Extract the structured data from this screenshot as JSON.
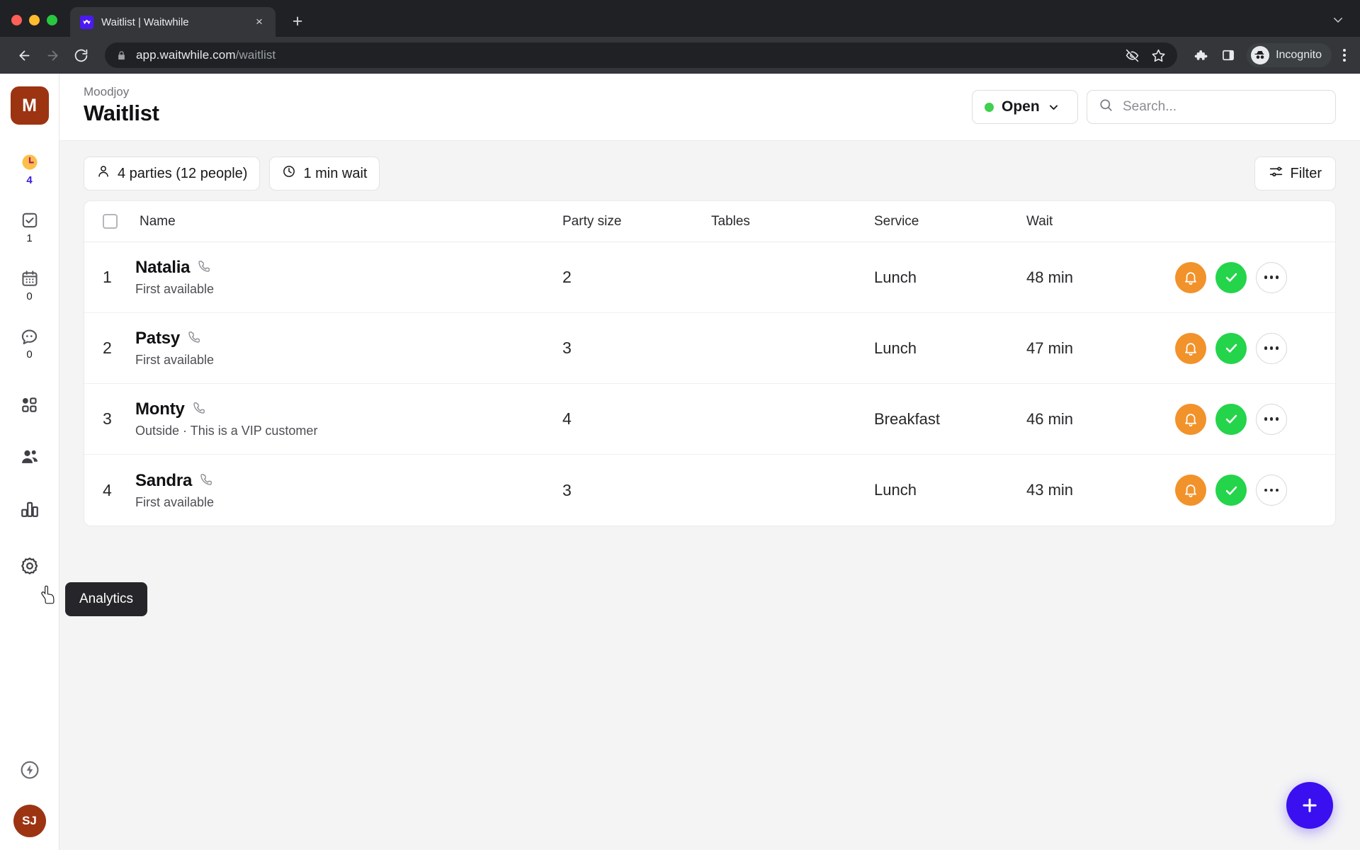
{
  "browser": {
    "tab": {
      "title": "Waitlist | Waitwhile",
      "favicon_name": "waitwhile-logo-icon",
      "close_label": "×"
    },
    "newtab_label": "+",
    "tabstrip_overflow_label": "⌄",
    "url": {
      "domain": "app.waitwhile.com",
      "path": "/waitlist"
    },
    "profile": {
      "label": "Incognito"
    },
    "icons": {
      "back": "back-arrow-icon",
      "forward": "forward-arrow-icon",
      "reload": "reload-icon",
      "lock": "lock-icon",
      "tracking_blocked": "eye-off-icon",
      "bookmark": "star-icon",
      "extensions": "puzzle-piece-icon",
      "side_panel": "side-panel-icon",
      "menu": "three-dot-menu-icon"
    }
  },
  "sidebar": {
    "brand_initial": "M",
    "items": [
      {
        "name": "waitlist",
        "icon": "clock-icon",
        "count": "4",
        "active": true
      },
      {
        "name": "served",
        "icon": "checkbox-check-icon",
        "count": "1",
        "active": false
      },
      {
        "name": "bookings",
        "icon": "calendar-icon",
        "count": "0",
        "active": false
      },
      {
        "name": "messages",
        "icon": "chat-bubble-icon",
        "count": "0",
        "active": false
      },
      {
        "name": "apps",
        "icon": "grid-squares-icon",
        "count": "",
        "active": false
      },
      {
        "name": "customers",
        "icon": "people-icon",
        "count": "",
        "active": false
      },
      {
        "name": "analytics",
        "icon": "bar-chart-icon",
        "count": "",
        "active": false
      },
      {
        "name": "settings",
        "icon": "gear-icon",
        "count": "",
        "active": false
      }
    ],
    "bottom": {
      "power_icon": "lightning-bolt-circle-icon",
      "avatar_initials": "SJ"
    }
  },
  "tooltip": {
    "label": "Analytics"
  },
  "header": {
    "org": "Moodjoy",
    "title": "Waitlist",
    "status": {
      "label": "Open",
      "dot_color": "#3fd14f",
      "chevron": "⌄"
    },
    "search": {
      "placeholder": "Search...",
      "value": "",
      "icon": "search-icon"
    }
  },
  "toolbar": {
    "parties_pill": {
      "label": "4 parties (12 people)",
      "icon": "person-icon"
    },
    "wait_pill": {
      "label": "1 min wait",
      "icon": "clock-icon"
    },
    "filter": {
      "label": "Filter",
      "icon": "filter-sliders-icon"
    }
  },
  "table": {
    "columns": [
      "Name",
      "Party size",
      "Tables",
      "Service",
      "Wait"
    ],
    "rows": [
      {
        "pos": "1",
        "name": "Natalia",
        "note": "First available",
        "party_size": "2",
        "tables": "",
        "service": "Lunch",
        "wait": "48 min",
        "phone_icon": "phone-icon"
      },
      {
        "pos": "2",
        "name": "Patsy",
        "note": "First available",
        "party_size": "3",
        "tables": "",
        "service": "Lunch",
        "wait": "47 min",
        "phone_icon": "phone-icon"
      },
      {
        "pos": "3",
        "name": "Monty",
        "note": "Outside  ·  This is a VIP customer",
        "party_size": "4",
        "tables": "",
        "service": "Breakfast",
        "wait": "46 min",
        "phone_icon": "phone-icon"
      },
      {
        "pos": "4",
        "name": "Sandra",
        "note": "First available",
        "party_size": "3",
        "tables": "",
        "service": "Lunch",
        "wait": "43 min",
        "phone_icon": "phone-icon"
      }
    ],
    "row_actions": {
      "notify": "bell-icon",
      "done": "check-icon",
      "more": "ellipsis-icon"
    }
  },
  "fab": {
    "label": "+",
    "color": "#3a0ff0"
  },
  "colors": {
    "brand_tile": "#9c3412",
    "accent_blue": "#3d1ae0",
    "notify_orange": "#f2922b",
    "done_green": "#24d44a",
    "status_green": "#3fd14f"
  }
}
